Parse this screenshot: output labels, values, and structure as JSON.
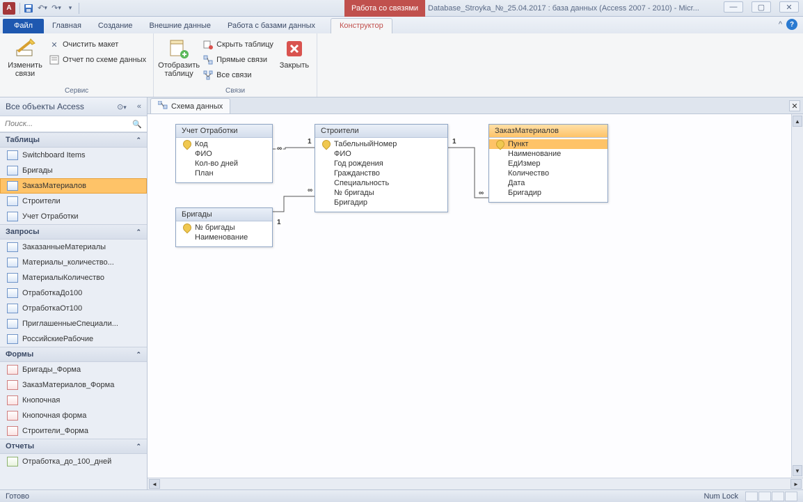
{
  "titlebar": {
    "app_letter": "A",
    "context_title": "Работа со связями",
    "window_title": "Database_Stroyka_№_25.04.2017 : база данных (Access 2007 - 2010)  -  Micr..."
  },
  "tabs": {
    "file": "Файл",
    "items": [
      "Главная",
      "Создание",
      "Внешние данные",
      "Работа с базами данных"
    ],
    "active": "Конструктор"
  },
  "ribbon": {
    "group1": {
      "title": "Сервис",
      "edit_relations": "Изменить связи",
      "clear_layout": "Очистить макет",
      "report": "Отчет по схеме данных"
    },
    "group2": {
      "title": "Связи",
      "show_table": "Отобразить таблицу",
      "hide_table": "Скрыть таблицу",
      "direct_relations": "Прямые связи",
      "all_relations": "Все связи",
      "close": "Закрыть"
    }
  },
  "nav": {
    "header": "Все объекты Access",
    "search_placeholder": "Поиск...",
    "cat_tables": "Таблицы",
    "tables": [
      "Switchboard Items",
      "Бригады",
      "ЗаказМатериалов",
      "Строители",
      "Учет Отработки"
    ],
    "tables_selected": "ЗаказМатериалов",
    "cat_queries": "Запросы",
    "queries": [
      "ЗаказанныеМатериалы",
      "Материалы_количество...",
      "МатериалыКоличество",
      "ОтработкаДо100",
      "ОтработкаОт100",
      "ПриглашенныеСпециали...",
      "РоссийскиеРабочие"
    ],
    "cat_forms": "Формы",
    "forms": [
      "Бригады_Форма",
      "ЗаказМатериалов_Форма",
      "Кнопочная",
      "Кнопочная форма",
      "Строители_Форма"
    ],
    "cat_reports": "Отчеты",
    "reports": [
      "Отработка_до_100_дней"
    ]
  },
  "doc": {
    "tab_title": "Схема данных"
  },
  "entities": {
    "e1": {
      "title": "Учет Отработки",
      "fields": [
        "Код",
        "ФИО",
        "Кол-во дней",
        "План"
      ],
      "pk": [
        "Код"
      ]
    },
    "e2": {
      "title": "Строители",
      "fields": [
        "ТабельныйНомер",
        "ФИО",
        "Год рождения",
        "Гражданство",
        "Специальность",
        "№ бригады",
        "Бригадир"
      ],
      "pk": [
        "ТабельныйНомер"
      ]
    },
    "e3": {
      "title": "ЗаказМатериалов",
      "fields": [
        "Пункт",
        "Наименование",
        "ЕдИзмер",
        "Количество",
        "Дата",
        "Бригадир"
      ],
      "pk": [
        "Пункт"
      ],
      "selected": true
    },
    "e4": {
      "title": "Бригады",
      "fields": [
        "№ бригады",
        "Наименование"
      ],
      "pk": [
        "№ бригады"
      ]
    }
  },
  "rel_labels": {
    "one": "1",
    "many": "∞"
  },
  "status": {
    "ready": "Готово",
    "numlock": "Num Lock"
  }
}
